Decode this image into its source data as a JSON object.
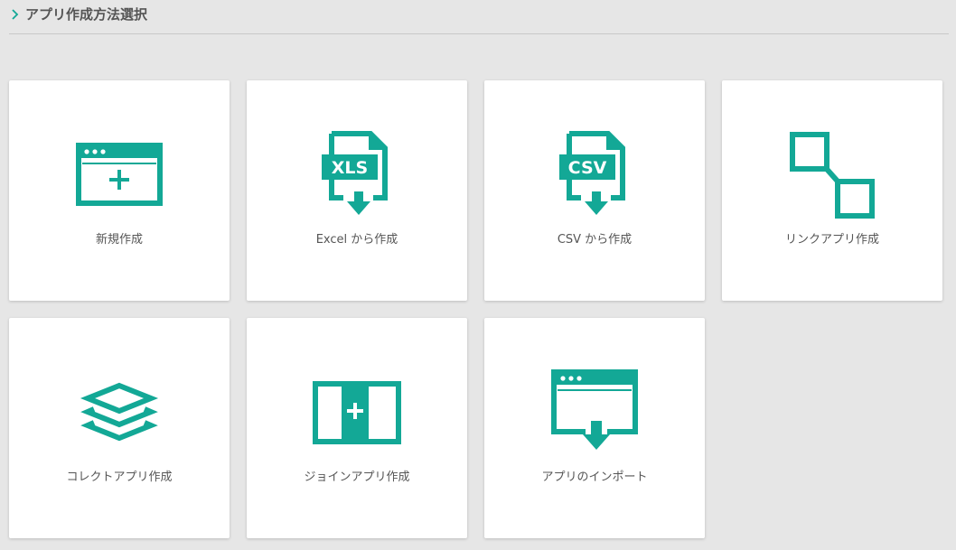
{
  "header": {
    "title": "アプリ作成方法選択",
    "icon": "chevron-right-icon"
  },
  "accent_color": "#13a896",
  "cards": [
    {
      "label": "新規作成",
      "icon": "new-app-window-icon"
    },
    {
      "label": "Excel から作成",
      "icon": "xls-file-icon",
      "badge": "XLS"
    },
    {
      "label": "CSV から作成",
      "icon": "csv-file-icon",
      "badge": "CSV"
    },
    {
      "label": "リンクアプリ作成",
      "icon": "link-app-icon"
    },
    {
      "label": "コレクトアプリ作成",
      "icon": "layers-icon"
    },
    {
      "label": "ジョインアプリ作成",
      "icon": "join-app-icon"
    },
    {
      "label": "アプリのインポート",
      "icon": "import-app-icon"
    }
  ]
}
